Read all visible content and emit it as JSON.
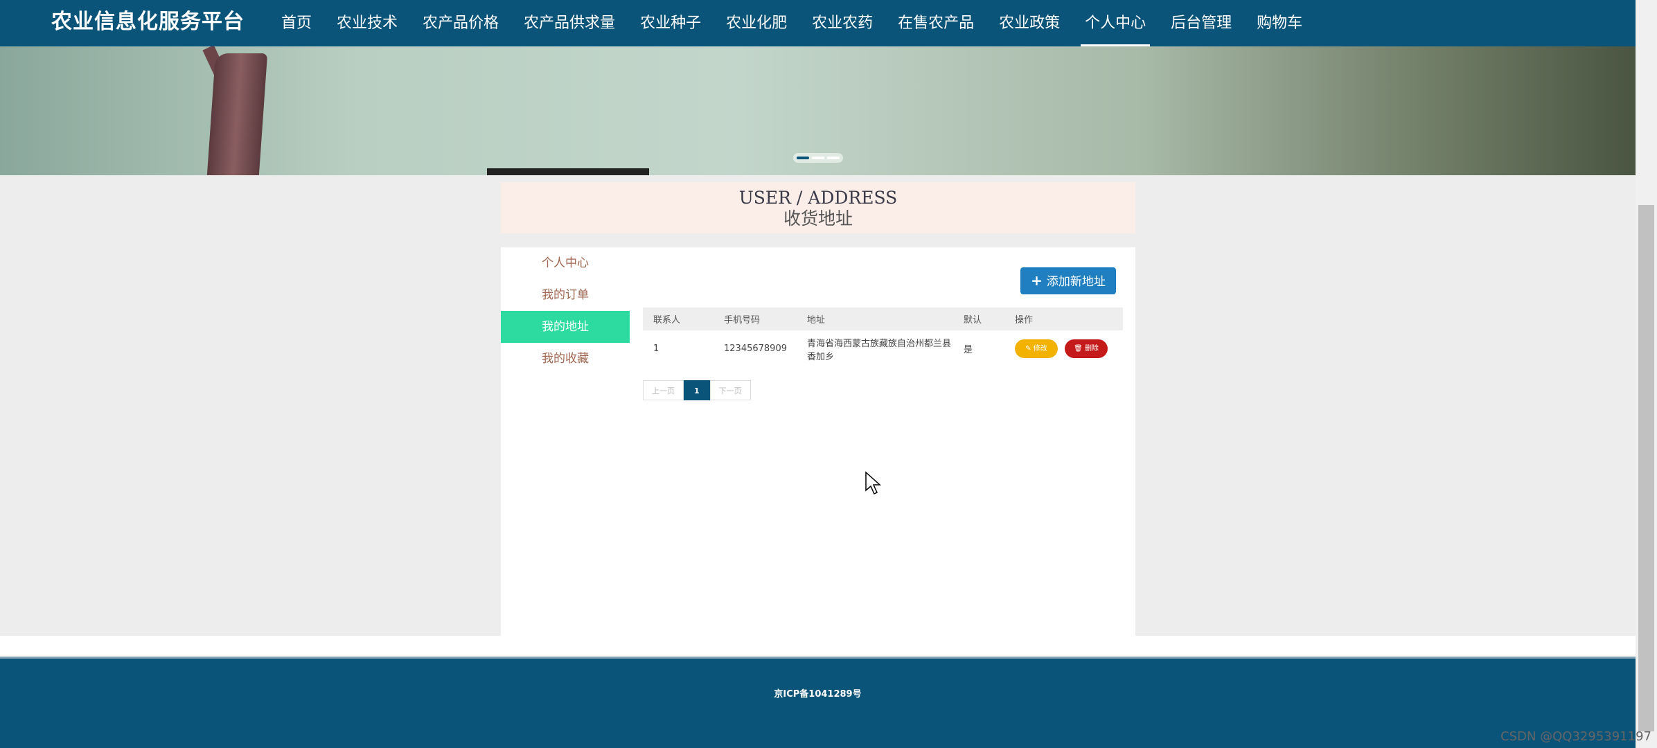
{
  "header": {
    "brand": "农业信息化服务平台",
    "nav": [
      {
        "label": "首页"
      },
      {
        "label": "农业技术"
      },
      {
        "label": "农产品价格"
      },
      {
        "label": "农产品供求量"
      },
      {
        "label": "农业种子"
      },
      {
        "label": "农业化肥"
      },
      {
        "label": "农业农药"
      },
      {
        "label": "在售农产品"
      },
      {
        "label": "农业政策"
      },
      {
        "label": "个人中心",
        "active": true
      },
      {
        "label": "后台管理"
      },
      {
        "label": "购物车"
      }
    ]
  },
  "page_title": {
    "en": "USER / ADDRESS",
    "cn": "收货地址"
  },
  "sidebar": {
    "items": [
      {
        "label": "个人中心"
      },
      {
        "label": "我的订单"
      },
      {
        "label": "我的地址",
        "active": true
      },
      {
        "label": "我的收藏"
      }
    ]
  },
  "toolbar": {
    "add_label": "添加新地址"
  },
  "table": {
    "headers": [
      "联系人",
      "手机号码",
      "地址",
      "默认",
      "操作"
    ],
    "rows": [
      {
        "contact": "1",
        "phone": "12345678909",
        "address": "青海省海西蒙古族藏族自治州都兰县香加乡",
        "default": "是",
        "edit_label": "修改",
        "delete_label": "删除"
      }
    ]
  },
  "pagination": {
    "prev": "上一页",
    "current": "1",
    "next": "下一页"
  },
  "footer": {
    "icp": "京ICP备1041289号"
  },
  "watermark": "CSDN @QQ3295391197",
  "colors": {
    "primary": "#0b5479",
    "accent": "#2ddba0",
    "edit": "#f3b200",
    "delete": "#c51a1a",
    "add": "#1f7fc0"
  }
}
